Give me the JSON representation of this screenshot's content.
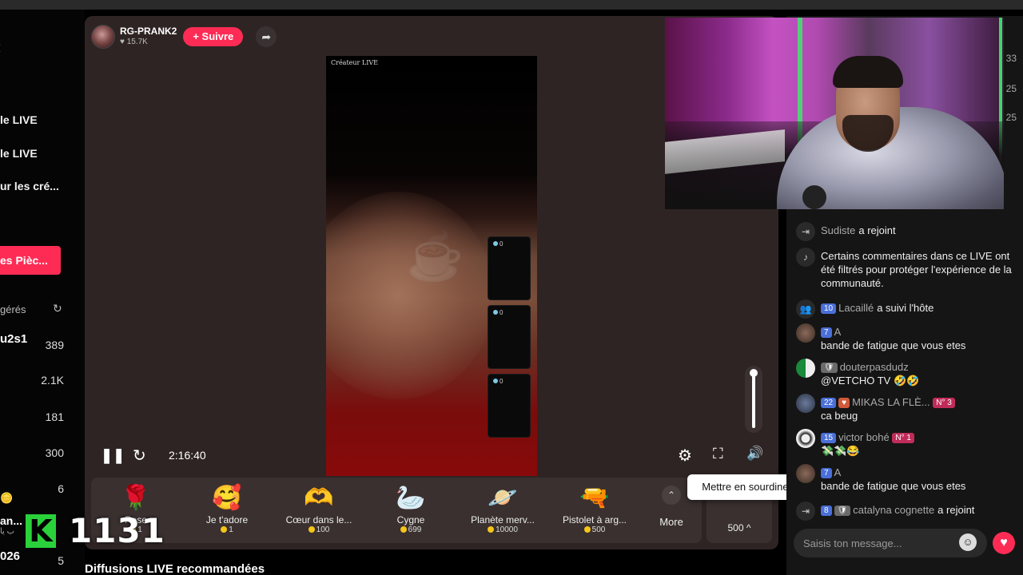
{
  "sidebar": {
    "links": [
      "le LIVE",
      "le LIVE",
      "ur les cré..."
    ],
    "coins_button": "es Pièc...",
    "managed_label": "gérés",
    "user": "u2s1",
    "counts": [
      "389",
      "2.1K",
      "181",
      "300",
      "6",
      "5"
    ],
    "an_label": "an...",
    "an_sub": "ب يا",
    "bottom_label": "026"
  },
  "overlay": {
    "k_letter": "K",
    "number": "1131"
  },
  "streamer": {
    "name": "RG-PRANK2",
    "likes": "15.7K",
    "follow_label": "+ Suivre"
  },
  "video": {
    "label": "Créateur LIVE",
    "guests": [
      {
        "badge": "0"
      },
      {
        "badge": "0"
      },
      {
        "badge": "0"
      }
    ]
  },
  "controls": {
    "timecode": "2:16:40",
    "tooltip": "Mettre en sourdine (M)",
    "volume_level": 1.0
  },
  "gifts": [
    {
      "icon": "🌹",
      "name": "Rose",
      "price": "1"
    },
    {
      "icon": "🥰",
      "name": "Je t'adore",
      "price": "1"
    },
    {
      "icon": "🫶",
      "name": "Cœur dans le...",
      "price": "100"
    },
    {
      "icon": "🦢",
      "name": "Cygne",
      "price": "699"
    },
    {
      "icon": "🪐",
      "name": "Planète merv...",
      "price": "10000"
    },
    {
      "icon": "🔫",
      "name": "Pistolet à arg...",
      "price": "500"
    }
  ],
  "more_label": "More",
  "coin_box_value": "500 ^",
  "recommended_title": "Diffusions LIVE recommandées",
  "chat": {
    "side_numbers": [
      "33",
      "25",
      "25"
    ],
    "messages": [
      {
        "type": "join",
        "name": "Sudiste",
        "action": "a rejoint"
      },
      {
        "type": "system",
        "text": "Certains commentaires dans ce LIVE ont été filtrés pour protéger l'expérience de la communauté."
      },
      {
        "type": "follow",
        "level": "10",
        "name": "Lacaillé",
        "action": "a suivi l'hôte"
      },
      {
        "type": "msg",
        "level": "7",
        "name": "A",
        "text": "bande de fatigue que vous etes"
      },
      {
        "type": "msg",
        "level": "",
        "name": "douterpasdudz",
        "text": "@VETCHO TV 🤣🤣"
      },
      {
        "type": "msg",
        "level": "22",
        "fan_level": "",
        "name": "MIKAS LA FLÈ...",
        "rank": "N° 3",
        "text": "ca beug"
      },
      {
        "type": "msg",
        "level": "15",
        "name": "victor bohé",
        "rank": "N° 1",
        "text": "💸💸😂"
      },
      {
        "type": "msg",
        "level": "7",
        "name": "A",
        "text": "bande de fatigue que vous etes"
      },
      {
        "type": "join",
        "level": "8",
        "name": "catalyna cognette",
        "action": "a rejoint"
      }
    ],
    "input_placeholder": "Saisis ton message..."
  },
  "colors": {
    "accent": "#fe2c55",
    "level_badge": "#4a6fd8",
    "kbox": "#2bd13a"
  }
}
